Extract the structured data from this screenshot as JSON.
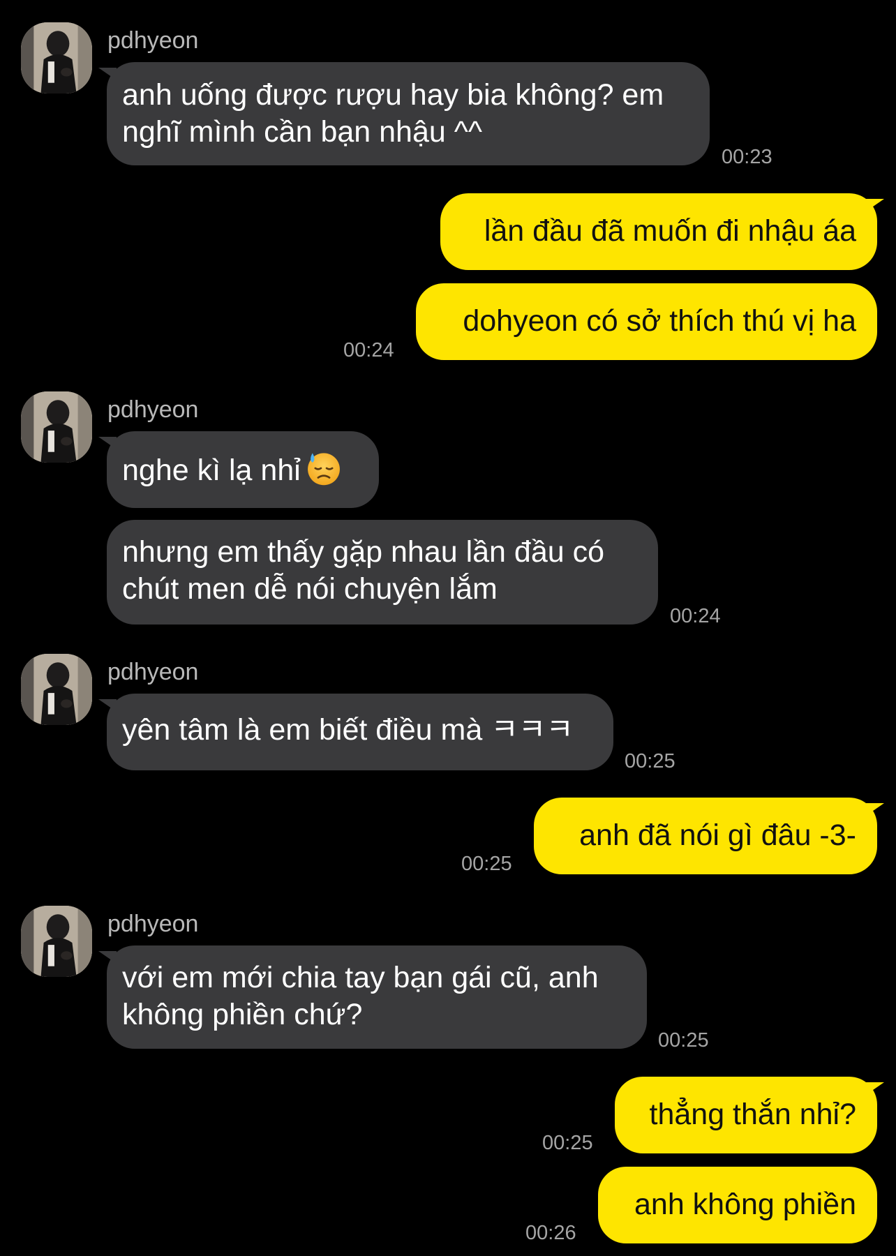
{
  "sender_name": "pdhyeon",
  "messages": [
    {
      "text": "anh uống được rượu hay bia không? em nghĩ mình cần bạn nhậu ^^",
      "time": "00:23"
    },
    {
      "text": "lần đầu đã muốn đi nhậu áa"
    },
    {
      "text": "dohyeon có sở thích thú vị ha",
      "time": "00:24"
    },
    {
      "text": "nghe kì lạ nhỉ",
      "emoji": "downcast-sweat-face"
    },
    {
      "text": "nhưng em thấy gặp nhau lần đầu có chút men dễ nói chuyện lắm",
      "time": "00:24"
    },
    {
      "text": "yên tâm là em biết điều mà ㅋㅋㅋ",
      "time": "00:25"
    },
    {
      "text": "anh đã nói gì đâu -3-",
      "time": "00:25"
    },
    {
      "text": "với em mới chia tay bạn gái cũ, anh không phiền chứ?",
      "time": "00:25"
    },
    {
      "text": "thẳng thắn nhỉ?",
      "time": "00:25"
    },
    {
      "text": "anh không phiền",
      "time": "00:26"
    }
  ],
  "colors": {
    "background": "#000000",
    "incoming_bubble": "#3a3a3c",
    "outgoing_bubble": "#fee500",
    "timestamp": "#a5a5a5"
  }
}
